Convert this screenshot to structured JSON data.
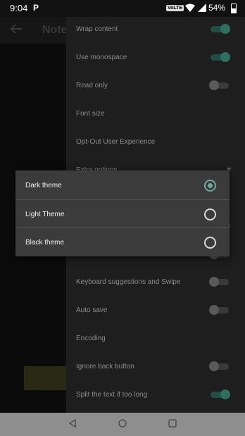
{
  "status_bar": {
    "time": "9:04",
    "network_label": "VoLTE",
    "battery_percent": "54%"
  },
  "background": {
    "title": "Note"
  },
  "settings": [
    {
      "label": "Wrap content",
      "toggle": "on"
    },
    {
      "label": "Use monospace",
      "toggle": "on"
    },
    {
      "label": "Read only",
      "toggle": "off"
    },
    {
      "label": "Font size",
      "toggle": null
    },
    {
      "label": "Opt-Out User Experience",
      "toggle": null
    },
    {
      "label": "Extra options",
      "toggle": null
    },
    {
      "label": "Keyboard suggestions and Swipe",
      "toggle": "off"
    },
    {
      "label": "Auto save",
      "toggle": "off"
    },
    {
      "label": "Encoding",
      "toggle": null
    },
    {
      "label": "Ignore back button",
      "toggle": "off"
    },
    {
      "label": "Split the text if too long",
      "toggle": "on"
    }
  ],
  "theme_dialog": {
    "options": [
      {
        "label": "Dark theme",
        "selected": true
      },
      {
        "label": "Light Theme",
        "selected": false
      },
      {
        "label": "Black theme",
        "selected": false
      }
    ]
  },
  "colors": {
    "accent": "#6fa89a",
    "dialog_bg": "#3b3b3b",
    "drawer_bg": "#1e1e1e"
  },
  "nav_bar": {
    "icons": [
      "back-icon",
      "home-icon",
      "recents-icon"
    ]
  }
}
